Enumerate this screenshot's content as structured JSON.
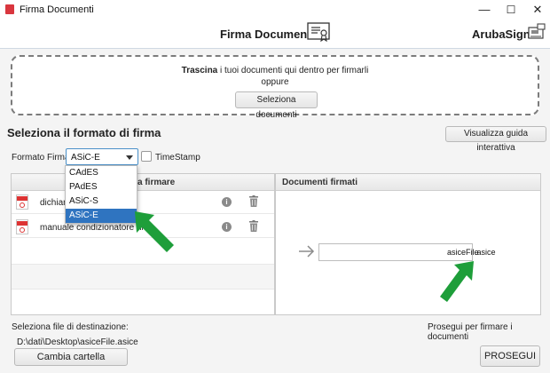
{
  "window": {
    "title": "Firma Documenti",
    "minimize": "—",
    "maximize": "☐",
    "close": "✕"
  },
  "header": {
    "title": "Firma Documenti",
    "brand": "ArubaSign"
  },
  "dropzone": {
    "line1_bold": "Trascina",
    "line1_rest": " i tuoi documenti qui dentro per firmarli",
    "line2": "oppure",
    "button": "Seleziona documenti"
  },
  "section": {
    "title": "Seleziona il formato di firma",
    "guide_button": "Visualizza guida interattiva"
  },
  "format": {
    "label": "Formato Firma:",
    "selected": "ASiC-E",
    "options": [
      "CAdES",
      "PAdES",
      "ASiC-S",
      "ASiC-E"
    ],
    "timestamp_label": "TimeStamp",
    "timestamp_checked": false
  },
  "left_panel": {
    "header": "ti da firmare",
    "rows": [
      {
        "name": "dichiara"
      },
      {
        "name": "manuale condizionatore hi"
      }
    ]
  },
  "right_panel": {
    "header": "Documenti firmati",
    "file_name": "asiceFile",
    "file_ext": ".asice"
  },
  "bottom": {
    "dest_label": "Seleziona file di destinazione:",
    "dest_path": "D:\\dati\\Desktop\\asiceFile.asice",
    "change_button": "Cambia cartella",
    "proceed_label": "Prosegui per firmare i documenti",
    "proceed_button": "PROSEGUI"
  },
  "colors": {
    "accent": "#2f74c0",
    "annotation_arrow": "#1e9e3a",
    "pdf_red": "#d33333"
  }
}
